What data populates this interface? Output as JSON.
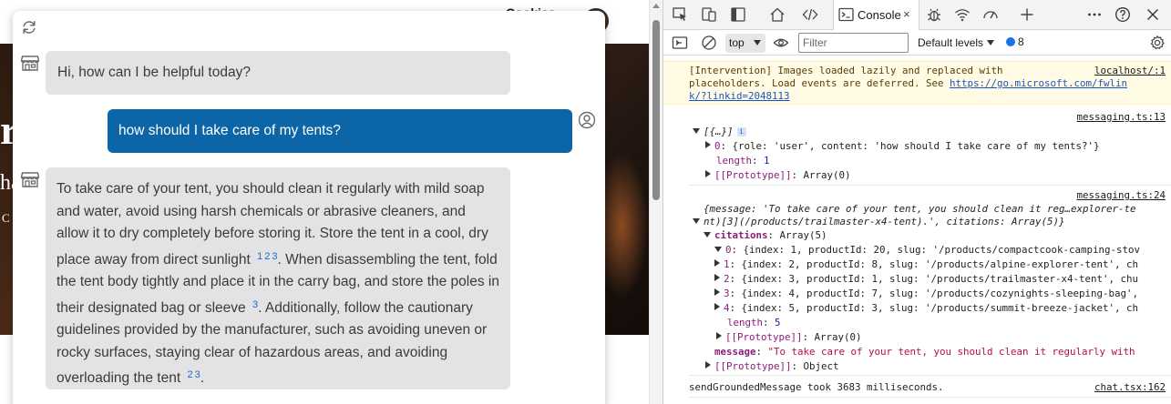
{
  "page": {
    "header_text": "Cookies",
    "hero_fragments": [
      "r",
      "ha",
      "C"
    ]
  },
  "chat": {
    "messages": [
      {
        "role": "assistant",
        "text": "Hi, how can I be helpful today?"
      },
      {
        "role": "user",
        "text": "how should I take care of my tents?"
      }
    ],
    "answer": {
      "segments": [
        {
          "text": "To take care of your tent, you should clean it regularly with mild soap and water, avoid using harsh chemicals or abrasive cleaners, and allow it to dry completely before storing it. Store the tent in a cool, dry place away from direct sunlight ",
          "cites": [
            "1",
            "2",
            "3"
          ]
        },
        {
          "text": ". When disassembling the tent, fold the tent body tightly and place it in the carry bag, and store the poles in their designated bag or sleeve ",
          "cites": [
            "3"
          ]
        },
        {
          "text": ". Additionally, follow the cautionary guidelines provided by the manufacturer, such as avoiding uneven or rocky surfaces, staying clear of hazardous areas, and avoiding overloading the tent ",
          "cites": [
            "2",
            "3"
          ]
        },
        {
          "text": ".",
          "cites": []
        }
      ]
    },
    "icons": {
      "refresh": "refresh-icon",
      "bot": "store-icon",
      "user": "user-circle-icon"
    }
  },
  "devtools": {
    "tabs": {
      "console_label": "Console",
      "close": "×"
    },
    "toolbar": {
      "context": "top",
      "filter_placeholder": "Filter",
      "levels_label": "Default levels",
      "issues_count": "8"
    },
    "console": {
      "intervention": {
        "line1": "[Intervention] Images loaded lazily and replaced with",
        "line2_prefix": "placeholders. Load events are deferred. See ",
        "link_part1": "https://go.microsoft.com/fwlin",
        "link_part2": "k/?linkid=2048113",
        "source": "localhost/:1"
      },
      "log1": {
        "source": "messaging.ts:13",
        "summary": "[{…}]",
        "item0_key": "0",
        "item0": "{role: 'user', content: 'how should I take care of my tents?'}",
        "length_key": "length",
        "length_val": "1",
        "proto_key": "[[Prototype]]",
        "proto_val": "Array(0)"
      },
      "log2": {
        "source": "messaging.ts:24",
        "summary_line1": "{message: 'To take care of your tent, you should clean it reg…explorer-te",
        "summary_line2": "nt)[3](/products/trailmaster-x4-tent).', citations: Array(5)}",
        "citations_key": "citations",
        "citations_val": "Array(5)",
        "items": [
          {
            "key": "0",
            "text": "{index: 1, productId: 20, slug: '/products/compactcook-camping-stov"
          },
          {
            "key": "1",
            "text": "{index: 2, productId: 8, slug: '/products/alpine-explorer-tent', ch"
          },
          {
            "key": "2",
            "text": "{index: 3, productId: 1, slug: '/products/trailmaster-x4-tent', chu"
          },
          {
            "key": "3",
            "text": "{index: 4, productId: 7, slug: '/products/cozynights-sleeping-bag',"
          },
          {
            "key": "4",
            "text": "{index: 5, productId: 3, slug: '/products/summit-breeze-jacket', ch"
          }
        ],
        "length_key": "length",
        "length_val": "5",
        "proto_key": "[[Prototype]]",
        "proto_val": "Array(0)",
        "message_key": "message",
        "message_val": "\"To take care of your tent, you should clean it regularly with",
        "obj_proto_key": "[[Prototype]]",
        "obj_proto_val": "Object"
      },
      "log3": {
        "text": "sendGroundedMessage took 3683 milliseconds.",
        "source": "chat.tsx:162"
      }
    }
  }
}
